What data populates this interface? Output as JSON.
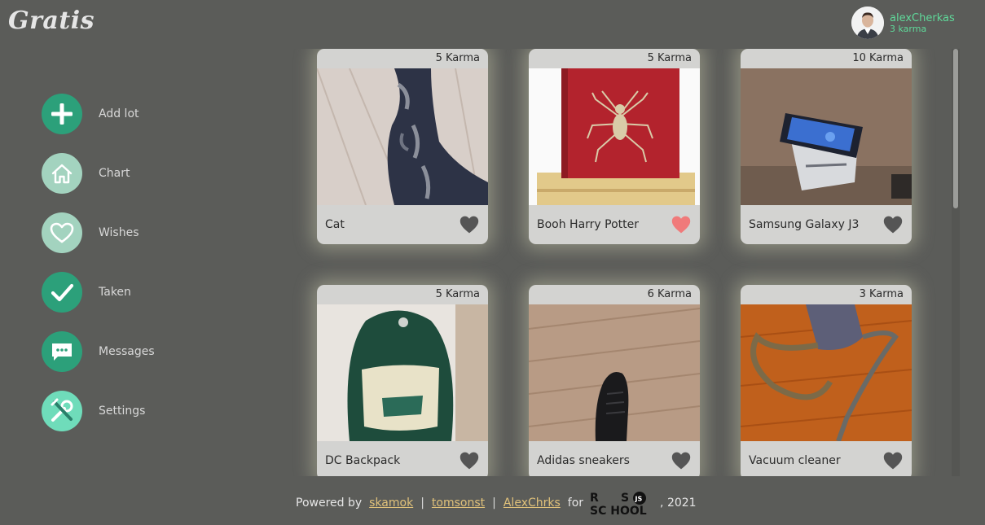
{
  "app": {
    "logo": "Gratis"
  },
  "user": {
    "name": "alexCherkas",
    "karma": "3 karma"
  },
  "sidebar": {
    "items": [
      {
        "label": "Add lot",
        "icon": "plus-icon",
        "color": "#2ca07a"
      },
      {
        "label": "Chart",
        "icon": "home-icon",
        "color": "#a3d3bf"
      },
      {
        "label": "Wishes",
        "icon": "heart-outline-icon",
        "color": "#a3d3bf"
      },
      {
        "label": "Taken",
        "icon": "check-icon",
        "color": "#2ca07a"
      },
      {
        "label": "Messages",
        "icon": "message-icon",
        "color": "#2ca07a"
      },
      {
        "label": "Settings",
        "icon": "tools-icon",
        "color": "#6fdcba"
      }
    ]
  },
  "lots": [
    {
      "karma": "5 Karma",
      "name": "Cat",
      "liked": false,
      "image": "cat"
    },
    {
      "karma": "5 Karma",
      "name": "Booh Harry Potter",
      "liked": true,
      "image": "book"
    },
    {
      "karma": "10 Karma",
      "name": "Samsung Galaxy J3",
      "liked": false,
      "image": "phone"
    },
    {
      "karma": "5 Karma",
      "name": "DC Backpack",
      "liked": false,
      "image": "backpack"
    },
    {
      "karma": "6 Karma",
      "name": "Adidas sneakers",
      "liked": false,
      "image": "sneakers"
    },
    {
      "karma": "3 Karma",
      "name": "Vacuum cleaner",
      "liked": false,
      "image": "vacuum"
    }
  ],
  "footer": {
    "powered": "Powered by",
    "authors": [
      "skamok",
      "tomsonst",
      "AlexChrks"
    ],
    "separator": "|",
    "for": "for",
    "school_logo": "RS SCHOOL JS",
    "year": ", 2021"
  },
  "colors": {
    "background": "#5b5c59",
    "card": "#d3d3d1",
    "accent": "#5fd99a",
    "liked_heart": "#f07a7a",
    "heart": "#555555",
    "link": "#e0c17a"
  }
}
